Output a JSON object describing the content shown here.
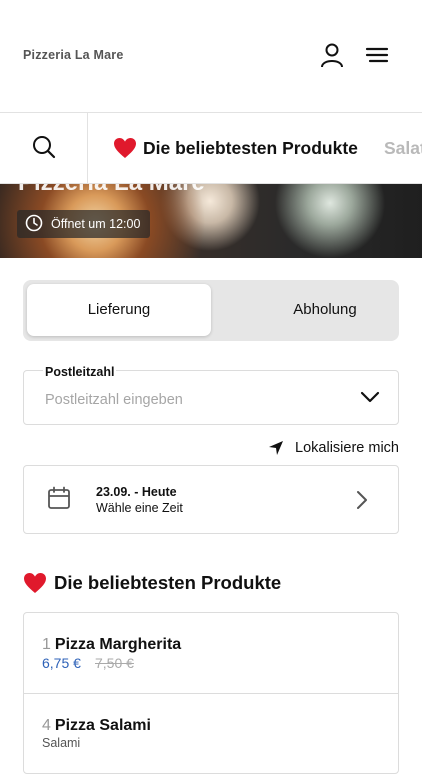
{
  "header": {
    "brand": "Pizzeria La Mare",
    "account_icon": "user-icon",
    "menu_icon": "hamburger-menu-icon"
  },
  "categories": {
    "search_icon": "search-icon",
    "active": {
      "emoji": "❤️",
      "label": "Die beliebtesten Produkte"
    },
    "next": "Salat"
  },
  "hero": {
    "title": "Pizzeria La Mare",
    "opening": "Öffnet um 12:00",
    "clock_icon": "clock-icon"
  },
  "delivery_toggle": {
    "options": [
      "Lieferung",
      "Abholung"
    ],
    "selected": "Lieferung"
  },
  "postcode": {
    "label": "Postleitzahl",
    "placeholder": "Postleitzahl eingeben"
  },
  "locate": {
    "label": "Lokalisiere mich",
    "icon": "location-arrow-icon"
  },
  "date": {
    "date": "23.09. - Heute",
    "time_hint": "Wähle eine Zeit",
    "icon": "calendar-icon"
  },
  "popular": {
    "emoji": "❤️",
    "title": "Die beliebtesten Produkte",
    "items": [
      {
        "number": "1",
        "name": "Pizza Margherita",
        "price": "6,75 €",
        "old_price": "7,50 €"
      },
      {
        "number": "4",
        "name": "Pizza Salami",
        "description": "Salami"
      }
    ]
  },
  "colors": {
    "price": "#2e62b8",
    "heart": "#e0192c",
    "border": "#dcdcdc"
  }
}
